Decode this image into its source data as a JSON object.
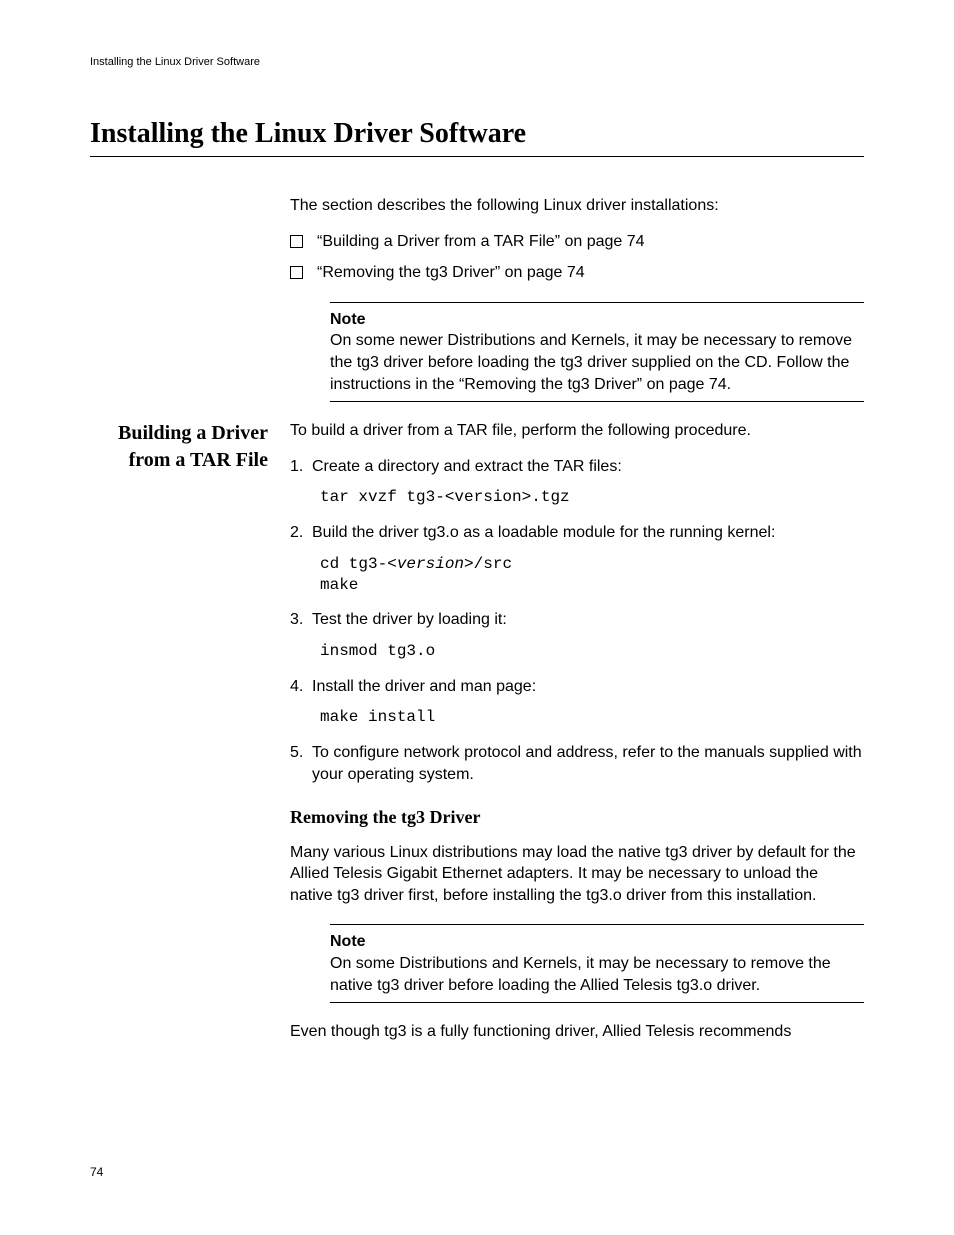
{
  "header": {
    "running": "Installing the Linux Driver Software"
  },
  "title": "Installing the Linux Driver Software",
  "intro": {
    "lead": "The section describes the following Linux driver installations:",
    "bullets": [
      "“Building a Driver from a TAR File” on page 74",
      "“Removing the tg3 Driver” on page 74"
    ],
    "note_label": "Note",
    "note_body": "On some newer Distributions and Kernels, it may be necessary to remove the tg3 driver before loading the tg3 driver supplied on the CD. Follow the instructions in the “Removing the tg3 Driver” on page 74."
  },
  "section1": {
    "side_heading": "Building a Driver from a TAR File",
    "lead": "To build a driver from a TAR file, perform the following procedure.",
    "steps": {
      "s1_num": "1.",
      "s1_text": "Create a directory and extract the TAR files:",
      "s1_code": "tar xvzf tg3-<version>.tgz",
      "s2_num": "2.",
      "s2_text": "Build the driver tg3.o as a loadable module for the running kernel:",
      "s2_code_a": "cd tg3-",
      "s2_code_b": "<version>",
      "s2_code_c": "/src",
      "s2_code_d": "make",
      "s3_num": "3.",
      "s3_text": "Test the driver by loading it:",
      "s3_code": "insmod tg3.o",
      "s4_num": "4.",
      "s4_text": "Install the driver and man page:",
      "s4_code": "make install",
      "s5_num": "5.",
      "s5_text": "To configure network protocol and address, refer to the manuals supplied with your operating system."
    },
    "sub_heading": "Removing the tg3 Driver",
    "sub_para": "Many various Linux distributions may load the native tg3 driver by default for the Allied Telesis Gigabit Ethernet adapters. It may be necessary to unload the native tg3 driver first, before installing the tg3.o driver from this installation.",
    "sub_note_label": "Note",
    "sub_note_body": "On some Distributions and Kernels, it may be necessary to remove the native tg3 driver before loading the Allied Telesis tg3.o driver.",
    "trailing": "Even though tg3 is a fully functioning driver, Allied Telesis recommends"
  },
  "page_number": "74"
}
